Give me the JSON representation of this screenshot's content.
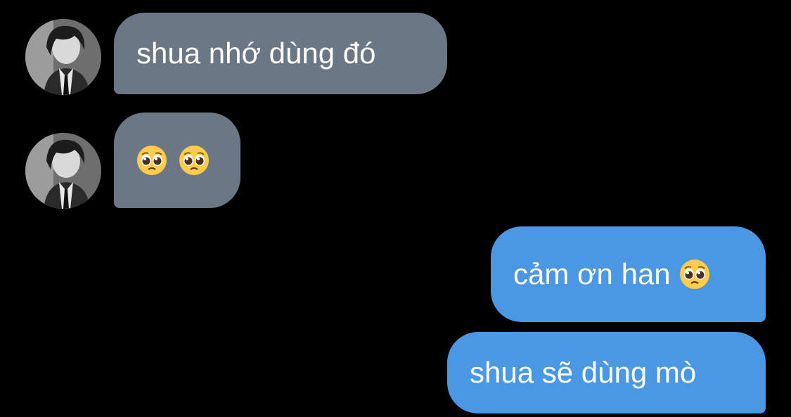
{
  "messages": [
    {
      "side": "incoming",
      "text": "shua nhớ dùng đó"
    },
    {
      "side": "incoming",
      "emojis": [
        "pleading-face",
        "pleading-face"
      ]
    },
    {
      "side": "outgoing",
      "text": "cảm ơn han",
      "emojis": [
        "pleading-face"
      ]
    },
    {
      "side": "outgoing",
      "text": "shua sẽ dùng mò"
    }
  ],
  "colors": {
    "background": "#000000",
    "incoming_bubble": "#6b7785",
    "outgoing_bubble": "#4a97e3",
    "text": "#ffffff"
  }
}
